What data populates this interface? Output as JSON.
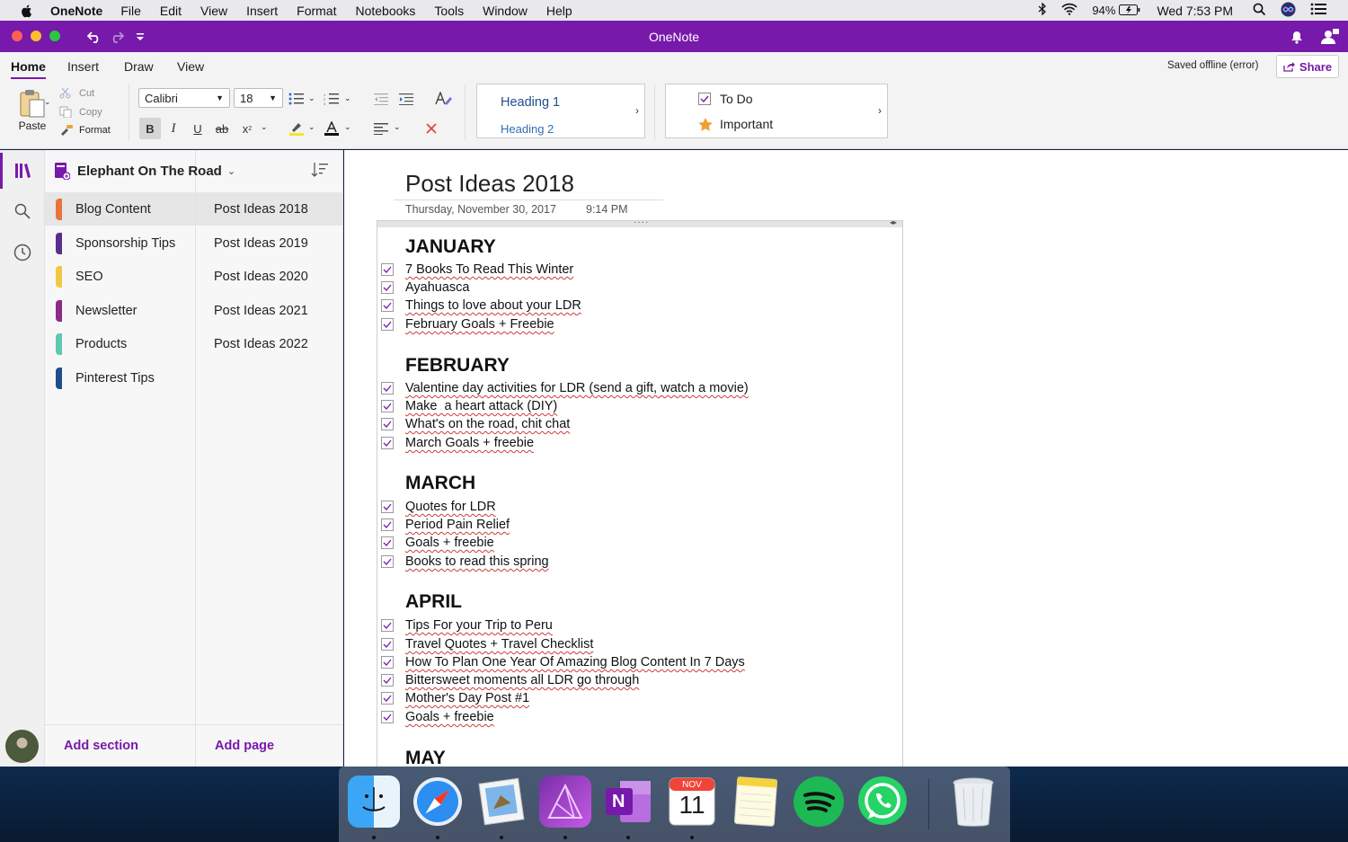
{
  "menubar": {
    "app_name": "OneNote",
    "items": [
      "File",
      "Edit",
      "View",
      "Insert",
      "Format",
      "Notebooks",
      "Tools",
      "Window",
      "Help"
    ],
    "battery": "94%",
    "clock": "Wed 7:53 PM"
  },
  "titlebar": {
    "title": "OneNote"
  },
  "ribbon": {
    "tabs": [
      "Home",
      "Insert",
      "Draw",
      "View"
    ],
    "saved_status": "Saved offline (error)",
    "share_label": "Share",
    "paste_label": "Paste",
    "cut_label": "Cut",
    "copy_label": "Copy",
    "format_label": "Format",
    "font_name": "Calibri",
    "font_size": "18",
    "heading1": "Heading 1",
    "heading2": "Heading 2",
    "tag_todo": "To Do",
    "tag_important": "Important"
  },
  "notebook": {
    "name": "Elephant On The Road",
    "sections": [
      {
        "label": "Blog Content",
        "color": "#e8743b"
      },
      {
        "label": "Sponsorship Tips",
        "color": "#5b2d8e"
      },
      {
        "label": "SEO",
        "color": "#f2c744"
      },
      {
        "label": "Newsletter",
        "color": "#8a2a8a"
      },
      {
        "label": "Products",
        "color": "#5ec8b0"
      },
      {
        "label": "Pinterest Tips",
        "color": "#1f4e8c"
      }
    ],
    "pages": [
      "Post Ideas 2018",
      "Post Ideas 2019",
      "Post Ideas 2020",
      "Post Ideas 2021",
      "Post Ideas 2022"
    ],
    "add_section": "Add section",
    "add_page": "Add page"
  },
  "page": {
    "title": "Post Ideas 2018",
    "date": "Thursday, November 30, 2017",
    "time": "9:14 PM",
    "months": [
      {
        "name": "JANUARY",
        "items": [
          "7 Books To Read This Winter",
          "Ayahuasca",
          "Things to love about your LDR",
          "February Goals + Freebie"
        ]
      },
      {
        "name": "FEBRUARY",
        "items": [
          "Valentine day activities for LDR (send a gift, watch a movie)",
          "Make  a heart attack (DIY)",
          "What's on the road, chit chat",
          "March Goals + freebie"
        ]
      },
      {
        "name": "MARCH",
        "items": [
          "Quotes for LDR",
          "Period Pain Relief",
          "Goals + freebie",
          "Books to read this spring"
        ]
      },
      {
        "name": "APRIL",
        "items": [
          "Tips For your Trip to Peru",
          "Travel Quotes + Travel Checklist",
          "How To Plan One Year Of Amazing Blog Content In 7 Days",
          "Bittersweet moments all LDR go through",
          "Mother's Day Post #1",
          "Goals + freebie"
        ]
      },
      {
        "name": "MAY",
        "items": []
      }
    ]
  },
  "dock": {
    "apps": [
      "finder-icon",
      "safari-icon",
      "preview-icon",
      "affinity-photo-icon",
      "onenote-icon",
      "calendar-icon",
      "notes-icon",
      "spotify-icon",
      "whatsapp-icon",
      "trash-icon"
    ],
    "calendar_month": "NOV",
    "calendar_day": "11",
    "onenote_letter": "N"
  },
  "colors": {
    "accent": "#7719aa"
  }
}
